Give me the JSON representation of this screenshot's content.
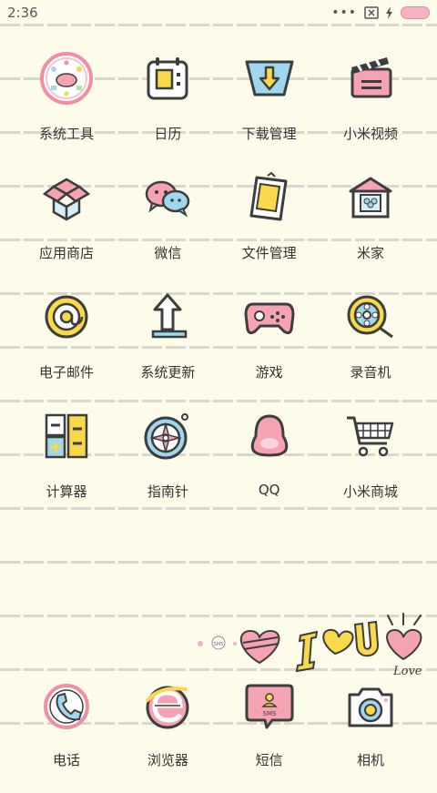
{
  "status": {
    "time": "2:36",
    "dots": "•••"
  },
  "apps": [
    {
      "label": "系统工具",
      "icon": "tools-icon"
    },
    {
      "label": "日历",
      "icon": "calendar-icon"
    },
    {
      "label": "下载管理",
      "icon": "download-icon"
    },
    {
      "label": "小米视频",
      "icon": "video-icon"
    },
    {
      "label": "应用商店",
      "icon": "appstore-icon"
    },
    {
      "label": "微信",
      "icon": "wechat-icon"
    },
    {
      "label": "文件管理",
      "icon": "file-manager-icon"
    },
    {
      "label": "米家",
      "icon": "mihome-icon"
    },
    {
      "label": "电子邮件",
      "icon": "email-icon"
    },
    {
      "label": "系统更新",
      "icon": "update-icon"
    },
    {
      "label": "游戏",
      "icon": "game-icon"
    },
    {
      "label": "录音机",
      "icon": "recorder-icon"
    },
    {
      "label": "计算器",
      "icon": "calculator-icon"
    },
    {
      "label": "指南针",
      "icon": "compass-icon"
    },
    {
      "label": "QQ",
      "icon": "qq-icon"
    },
    {
      "label": "小米商城",
      "icon": "shop-icon"
    }
  ],
  "dock": [
    {
      "label": "电话",
      "icon": "phone-icon"
    },
    {
      "label": "浏览器",
      "icon": "browser-icon"
    },
    {
      "label": "短信",
      "icon": "sms-icon",
      "badge": "SMS"
    },
    {
      "label": "相机",
      "icon": "camera-icon"
    }
  ],
  "decor": {
    "love_text": "Love",
    "sms_text": "SMS"
  },
  "colors": {
    "pink": "#f59fb0",
    "yellow": "#f9d94c",
    "blue": "#9fd8ee",
    "outline": "#3d3d3d"
  }
}
